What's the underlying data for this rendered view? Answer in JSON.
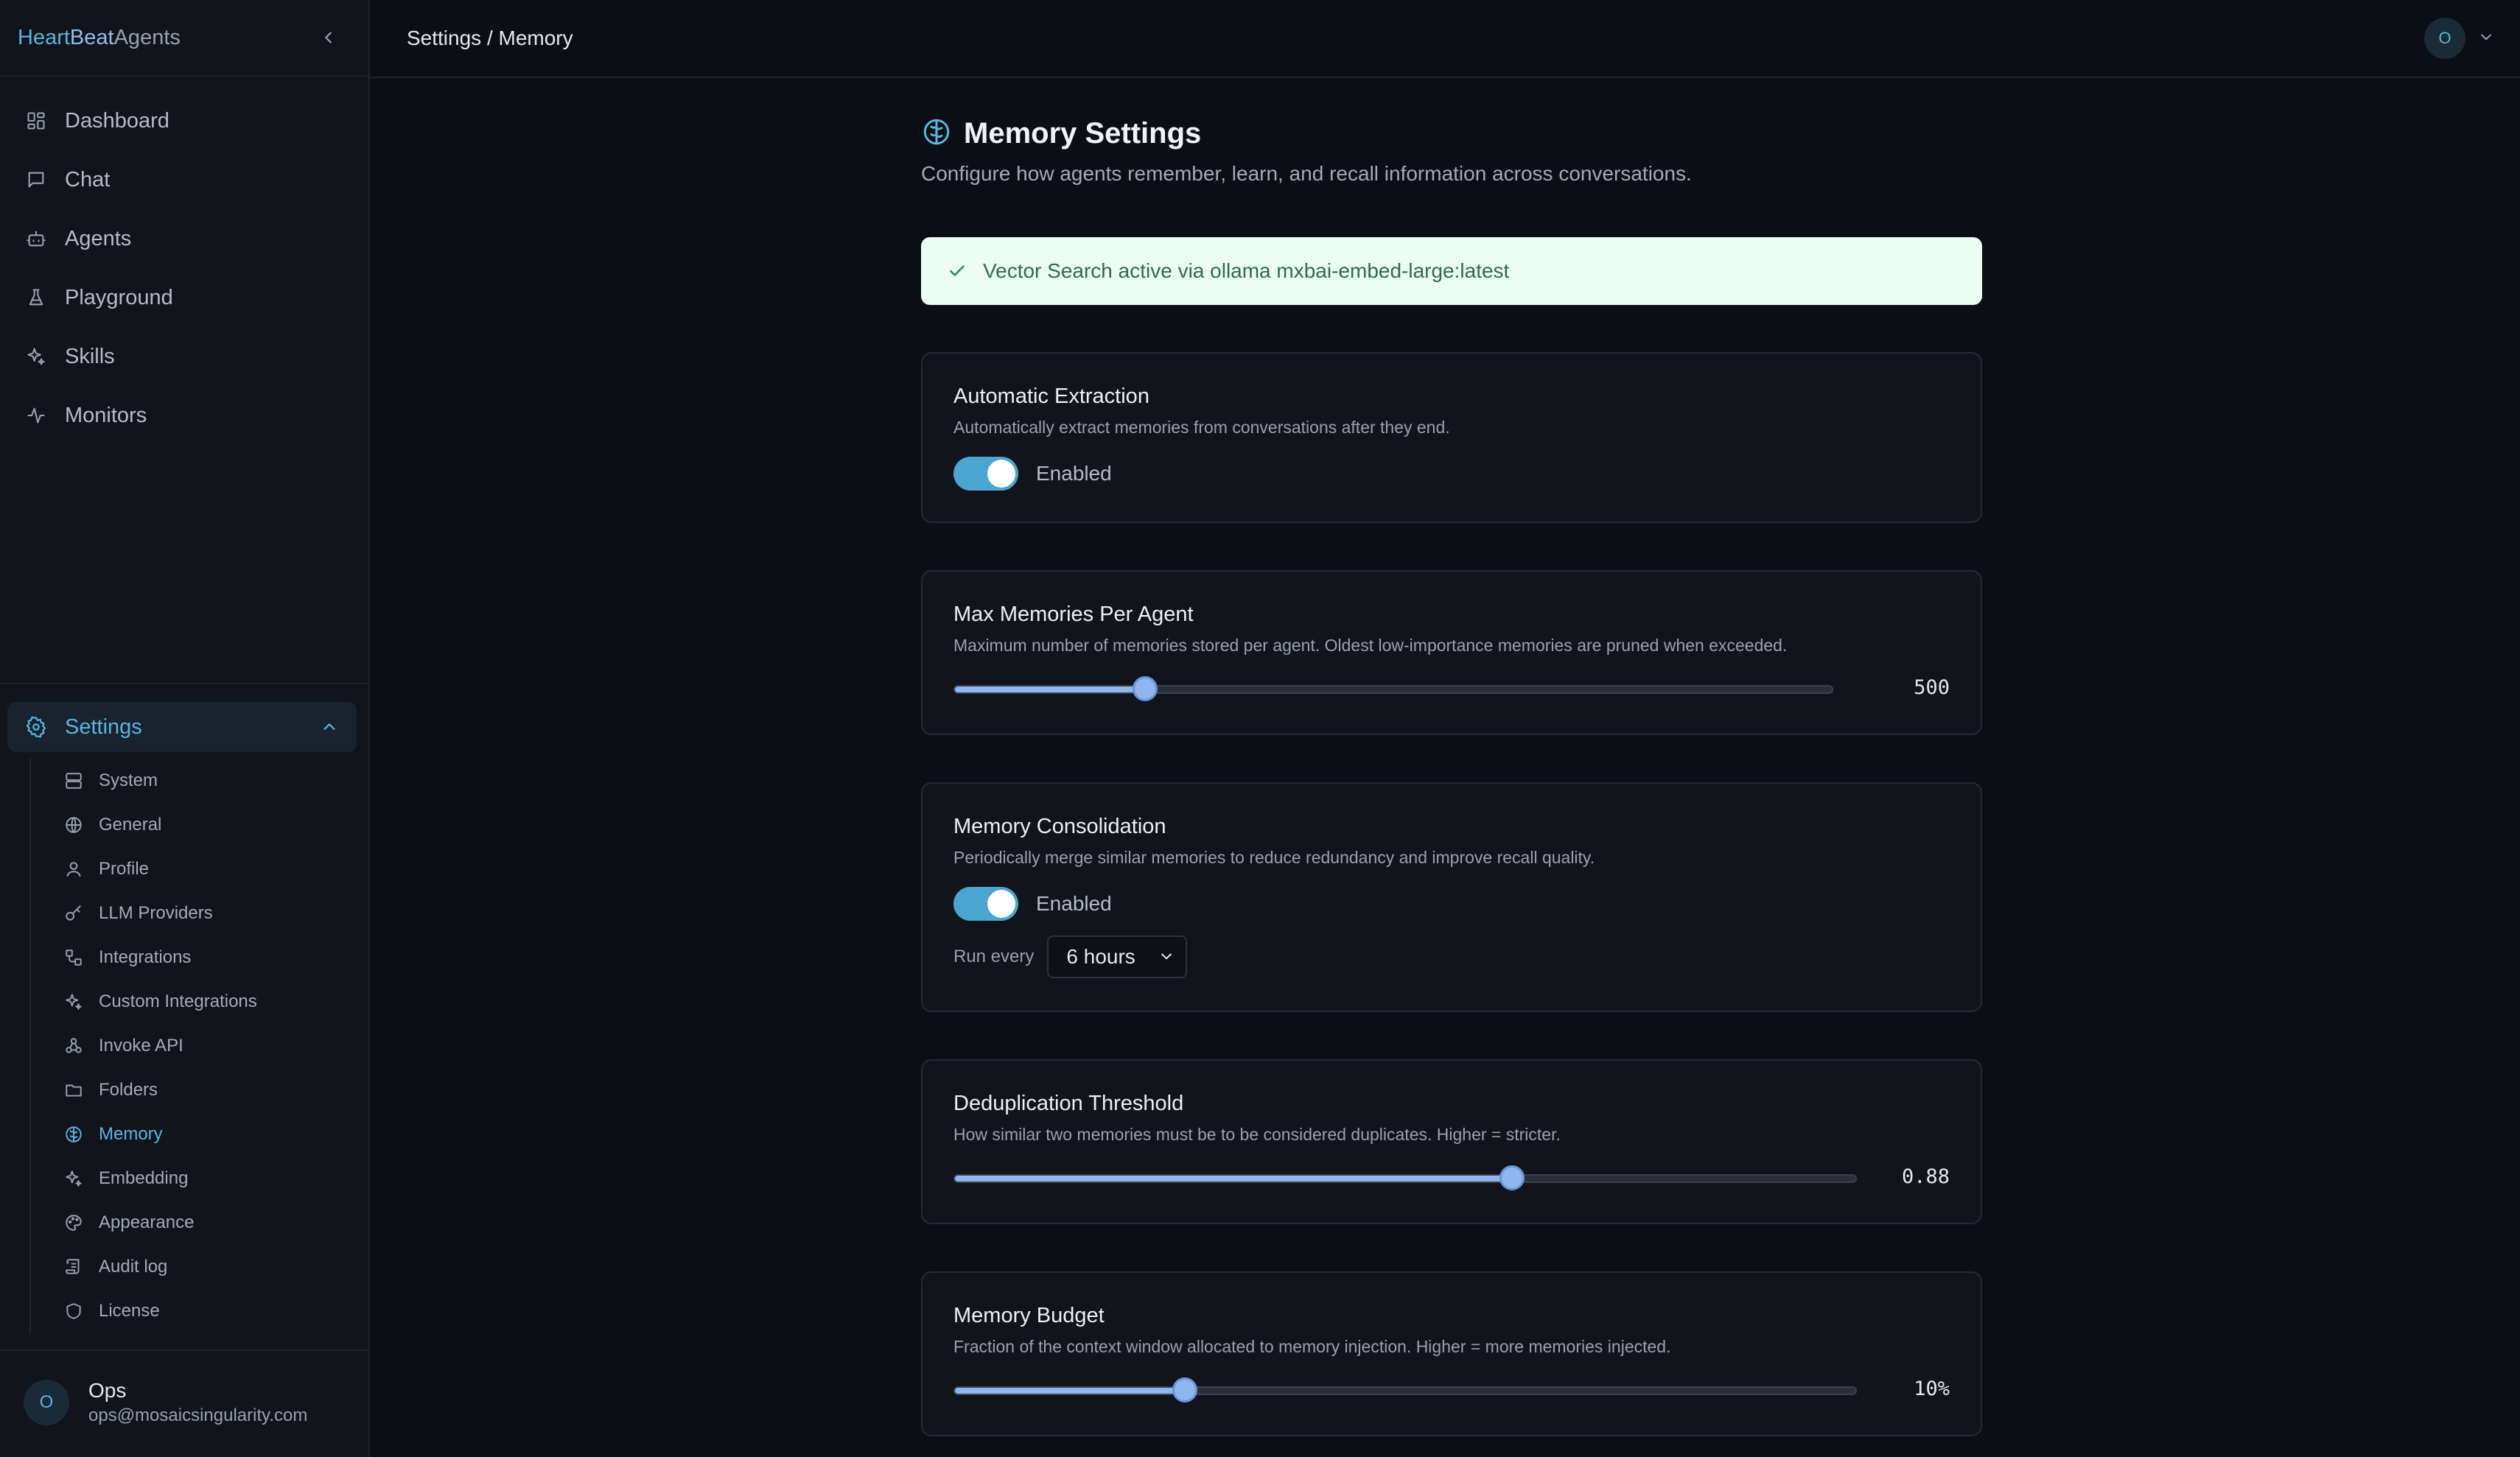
{
  "brand": {
    "part1": "Heart",
    "part2": "Beat",
    "part3": "Agents"
  },
  "nav": [
    {
      "label": "Dashboard",
      "icon": "dashboard-icon"
    },
    {
      "label": "Chat",
      "icon": "chat-icon"
    },
    {
      "label": "Agents",
      "icon": "bot-icon"
    },
    {
      "label": "Playground",
      "icon": "flask-icon"
    },
    {
      "label": "Skills",
      "icon": "sparkles-icon"
    },
    {
      "label": "Monitors",
      "icon": "activity-icon"
    }
  ],
  "settings": {
    "label": "Settings",
    "items": [
      {
        "label": "System",
        "icon": "server-icon"
      },
      {
        "label": "General",
        "icon": "globe-icon"
      },
      {
        "label": "Profile",
        "icon": "user-icon"
      },
      {
        "label": "LLM Providers",
        "icon": "key-icon"
      },
      {
        "label": "Integrations",
        "icon": "workflow-icon"
      },
      {
        "label": "Custom Integrations",
        "icon": "sparkles-icon"
      },
      {
        "label": "Invoke API",
        "icon": "webhook-icon"
      },
      {
        "label": "Folders",
        "icon": "folder-icon"
      },
      {
        "label": "Memory",
        "icon": "brain-icon",
        "active": true
      },
      {
        "label": "Embedding",
        "icon": "sparkles-icon"
      },
      {
        "label": "Appearance",
        "icon": "palette-icon"
      },
      {
        "label": "Audit log",
        "icon": "scroll-icon"
      },
      {
        "label": "License",
        "icon": "shield-icon"
      }
    ]
  },
  "user": {
    "initial": "O",
    "name": "Ops",
    "email": "ops@mosaicsingularity.com"
  },
  "topbar": {
    "breadcrumb": "Settings / Memory",
    "avatar_initial": "O"
  },
  "page": {
    "title": "Memory Settings",
    "description": "Configure how agents remember, learn, and recall information across conversations.",
    "alert": "Vector Search active via ollama mxbai-embed-large:latest"
  },
  "cards": {
    "extraction": {
      "title": "Automatic Extraction",
      "description": "Automatically extract memories from conversations after they end.",
      "toggle_label": "Enabled",
      "enabled": true
    },
    "max_memories": {
      "title": "Max Memories Per Agent",
      "description": "Maximum number of memories stored per agent. Oldest low-importance memories are pruned when exceeded.",
      "value": "500",
      "fraction": 0.218
    },
    "consolidation": {
      "title": "Memory Consolidation",
      "description": "Periodically merge similar memories to reduce redundancy and improve recall quality.",
      "toggle_label": "Enabled",
      "enabled": true,
      "run_every_label": "Run every",
      "run_every_value": "6 hours"
    },
    "dedup": {
      "title": "Deduplication Threshold",
      "description": "How similar two memories must be to be considered duplicates. Higher = stricter.",
      "value": "0.88",
      "fraction": 0.618
    },
    "budget": {
      "title": "Memory Budget",
      "description": "Fraction of the context window allocated to memory injection. Higher = more memories injected.",
      "value": "10%",
      "fraction": 0.256
    }
  },
  "colors": {
    "accent": "#5ab4de",
    "slider": "#8fb6ee",
    "success_bg": "#ecfdf3",
    "success_text": "#2f6b4c"
  }
}
